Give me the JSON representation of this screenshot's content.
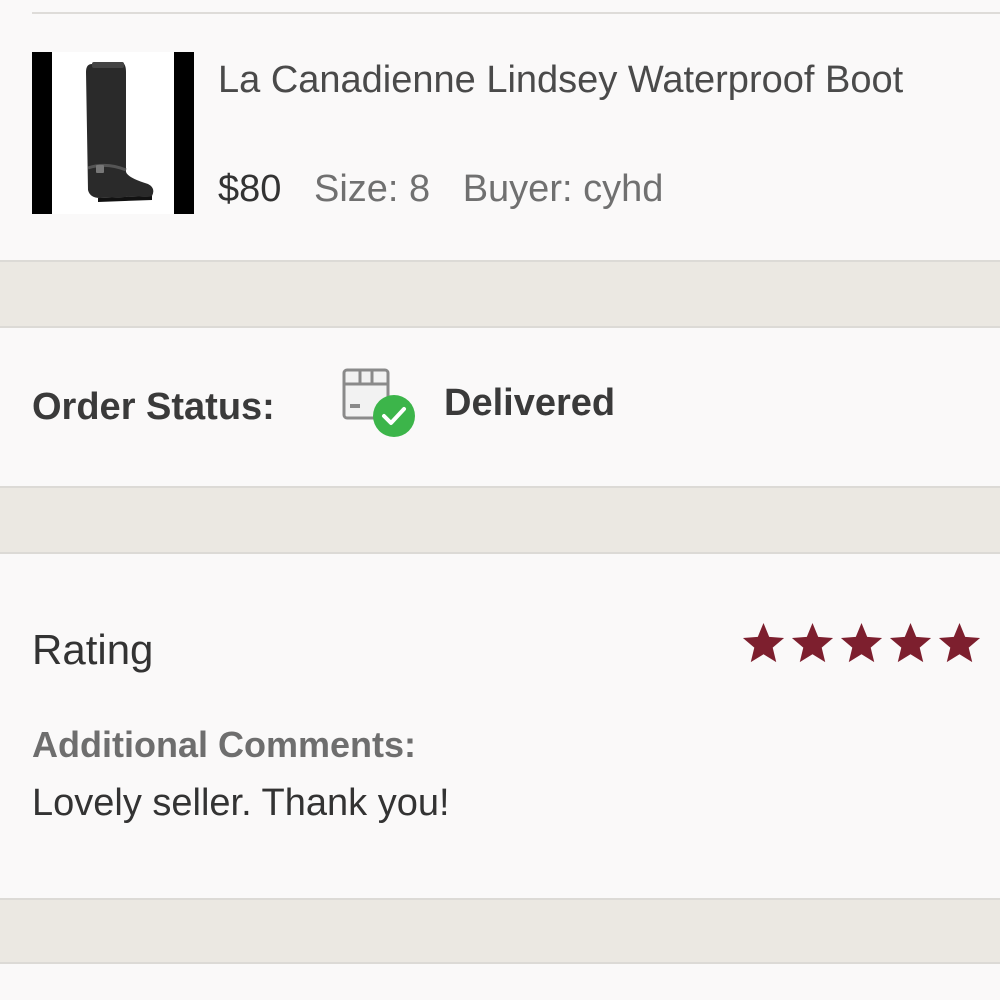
{
  "product": {
    "title": "La Canadienne Lindsey Waterproof Boot",
    "price": "$80",
    "size": "Size: 8",
    "buyer": "Buyer: cyhd",
    "image_icon": "boot-image"
  },
  "order": {
    "status_label": "Order Status:",
    "status_value": "Delivered",
    "status_icon": "package-delivered-icon",
    "status_color": "#3cb54a"
  },
  "rating": {
    "label": "Rating",
    "stars": 5,
    "max_stars": 5,
    "star_color": "#7d1f2e",
    "comments_label": "Additional Comments:",
    "comments_text": "Lovely seller. Thank you!"
  }
}
